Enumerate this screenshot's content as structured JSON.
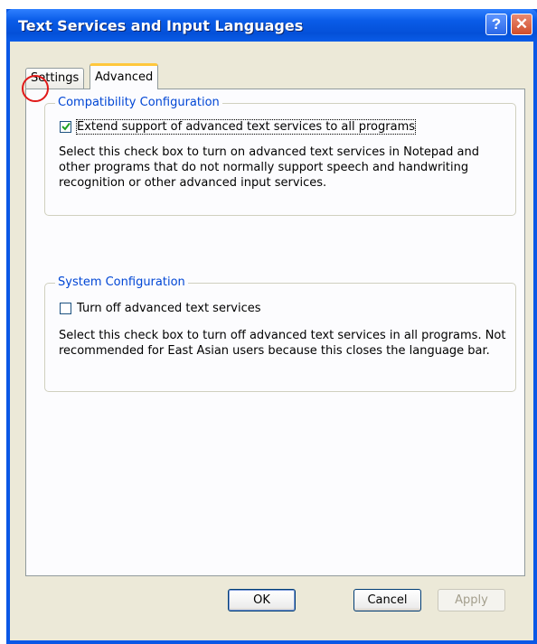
{
  "window": {
    "title": "Text Services and Input Languages",
    "help_glyph": "?",
    "close_glyph": "✕"
  },
  "tabs": [
    {
      "label": "Settings",
      "selected": false
    },
    {
      "label": "Advanced",
      "selected": true
    }
  ],
  "compatibility": {
    "legend": "Compatibility Configuration",
    "checkbox_label": "Extend support of advanced text services to all programs",
    "checked": true,
    "description": "Select this check box to turn on advanced text services in Notepad and other programs that do not normally support speech and handwriting recognition or other advanced input services."
  },
  "system": {
    "legend": "System Configuration",
    "checkbox_label": "Turn off advanced text services",
    "checked": false,
    "description": "Select this check box to turn off advanced text services in all programs. Not recommended for East Asian users because this closes the language bar."
  },
  "buttons": {
    "ok": "OK",
    "cancel": "Cancel",
    "apply": "Apply",
    "apply_enabled": false
  },
  "colors": {
    "title_bar": "#0a5ce8",
    "group_legend": "#0046d5",
    "annotation": "#e01818"
  },
  "icons": {
    "help": "help-icon",
    "close": "close-icon",
    "checkmark": "checkmark-icon"
  }
}
